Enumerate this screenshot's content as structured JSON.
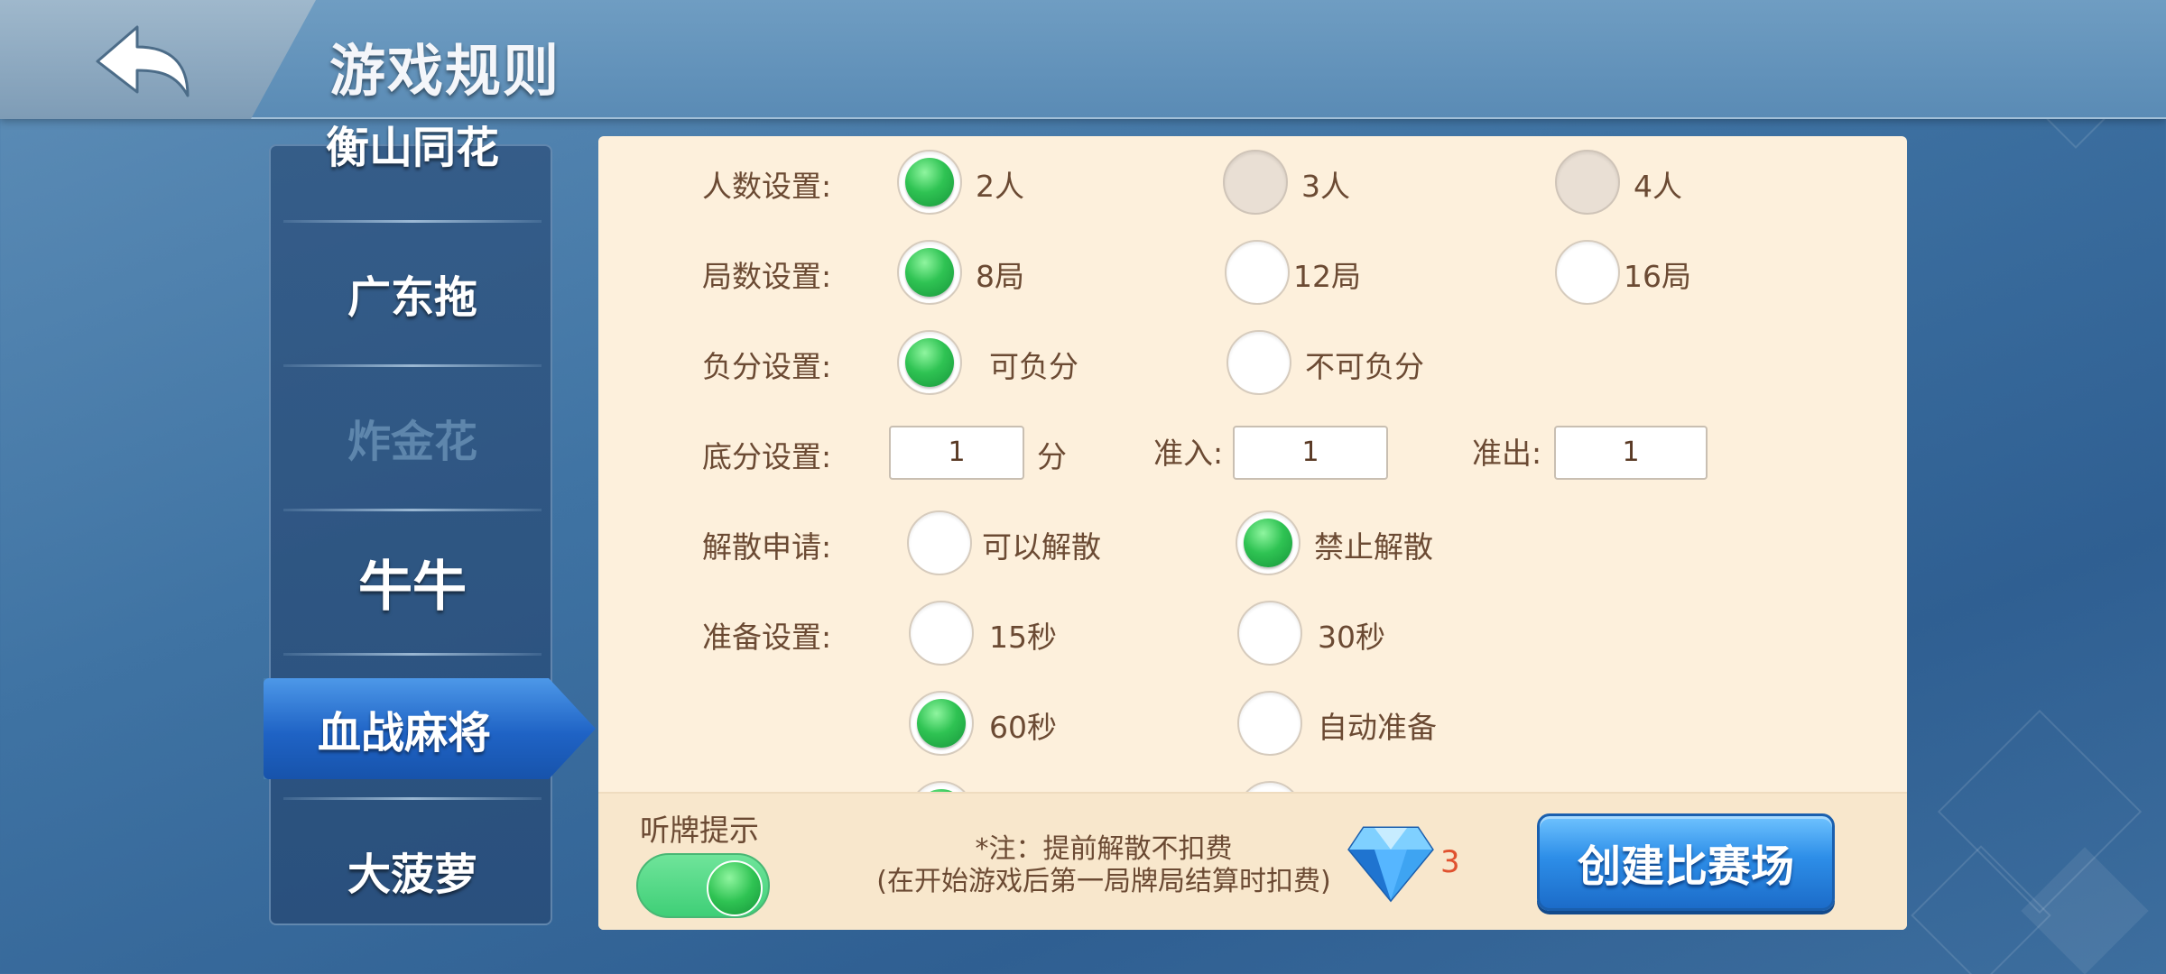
{
  "header": {
    "title": "游戏规则",
    "back_icon": "back-arrow-icon"
  },
  "sidebar": {
    "items": [
      {
        "label": "衡山同花",
        "state": "cut-off"
      },
      {
        "label": "广东拖"
      },
      {
        "label": "炸金花",
        "state": "disabled"
      },
      {
        "label": "牛牛"
      },
      {
        "label": "血战麻将",
        "state": "active"
      },
      {
        "label": "大菠萝"
      }
    ]
  },
  "rules": {
    "players": {
      "label": "人数设置:",
      "options": [
        "2人",
        "3人",
        "4人"
      ],
      "selected": "2人"
    },
    "rounds": {
      "label": "局数设置:",
      "options": [
        "8局",
        "12局",
        "16局"
      ],
      "selected": "8局"
    },
    "negative": {
      "label": "负分设置:",
      "options": [
        "可负分",
        "不可负分"
      ],
      "selected": "可负分"
    },
    "base_score": {
      "label": "底分设置:",
      "value": "1",
      "unit": "分",
      "entry_label": "准入:",
      "entry_value": "1",
      "exit_label": "准出:",
      "exit_value": "1"
    },
    "dissolve": {
      "label": "解散申请:",
      "options": [
        "可以解散",
        "禁止解散"
      ],
      "selected": "禁止解散"
    },
    "ready": {
      "label": "准备设置:",
      "options": [
        "15秒",
        "30秒",
        "60秒",
        "自动准备"
      ],
      "selected": "60秒"
    }
  },
  "footer": {
    "ting_label": "听牌提示",
    "ting_on": true,
    "note_line1": "*注：提前解散不扣费",
    "note_line2": "(在开始游戏后第一局牌局结算时扣费)",
    "gem_count": "3",
    "create_label": "创建比赛场"
  },
  "colors": {
    "accent_green": "#2fc353",
    "panel_bg": "#fdf0dc",
    "button_blue": "#2d8ee8",
    "gem_count": "#e0522f"
  }
}
